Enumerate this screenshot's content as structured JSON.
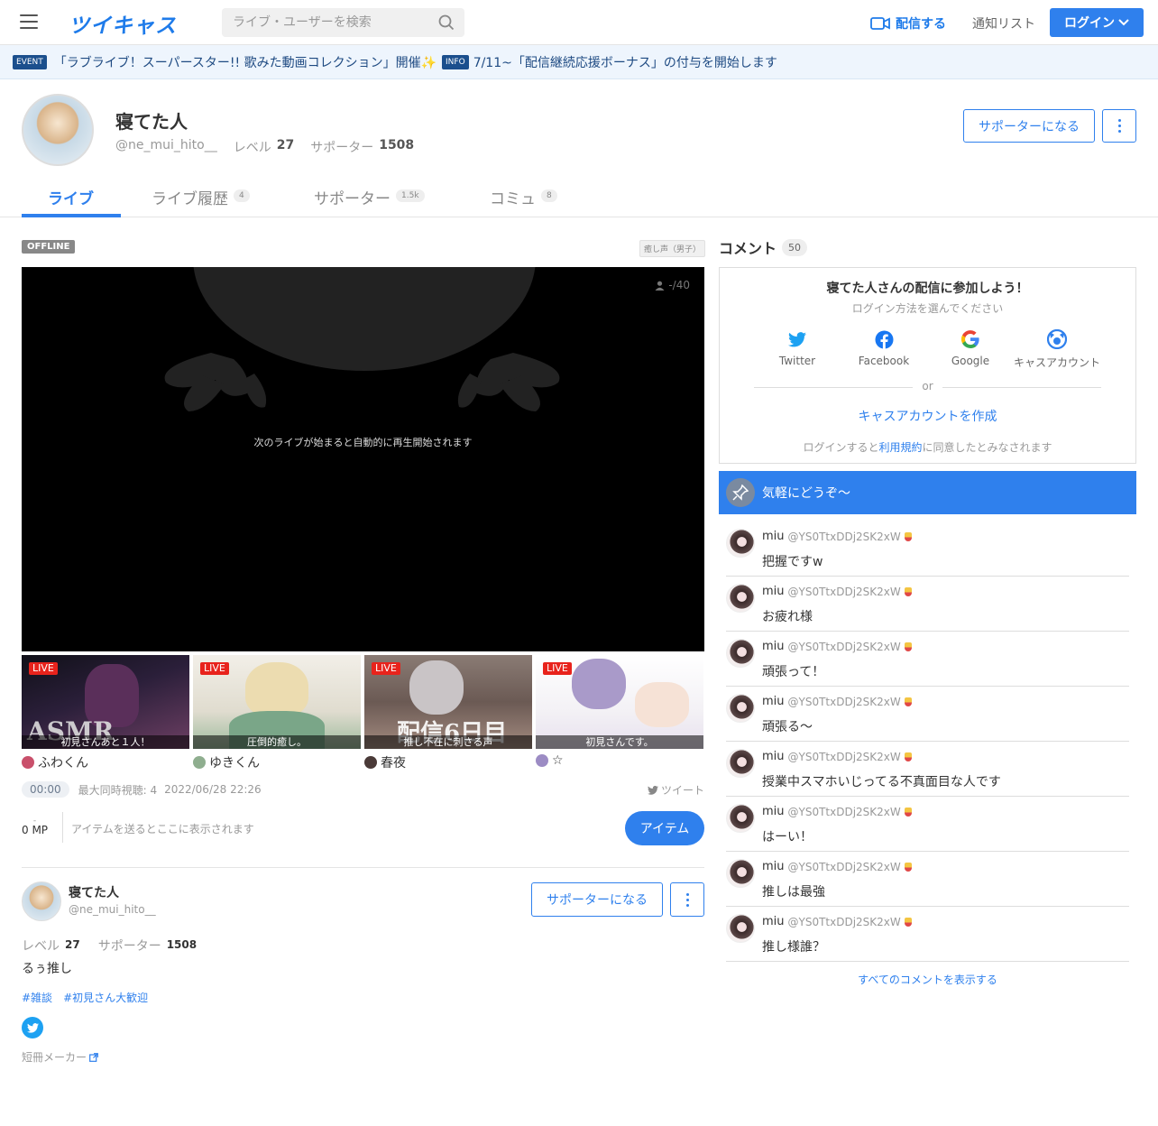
{
  "header": {
    "logo": "ツイキャス",
    "search_placeholder": "ライブ・ユーザーを検索",
    "broadcast_label": "配信する",
    "notify_label": "通知リスト",
    "login_label": "ログイン"
  },
  "ticker": {
    "event_badge": "EVENT",
    "event_text": "「ラブライブ！スーパースター!! 歌みた動画コレクション」開催✨",
    "info_badge": "INFO",
    "info_text": "7/11~「配信継続応援ボーナス」の付与を開始します"
  },
  "profile": {
    "name": "寝てた人",
    "handle": "@ne_mui_hito__",
    "level_label": "レベル",
    "level": "27",
    "supporter_label": "サポーター",
    "supporters": "1508",
    "support_button": "サポーターになる"
  },
  "tabs": [
    {
      "label": "ライブ",
      "count": ""
    },
    {
      "label": "ライブ履歴",
      "count": "4"
    },
    {
      "label": "サポーター",
      "count": "1.5k"
    },
    {
      "label": "コミュ",
      "count": "8"
    }
  ],
  "live": {
    "status": "OFFLINE",
    "category": "癒し声（男子）",
    "viewers": "-/40",
    "player_message": "次のライブが始まると自動的に再生開始されます",
    "time": "00:00",
    "max_viewers": "最大同時視聴: 4",
    "date": "2022/06/28 22:26",
    "tweet_label": "ツイート",
    "mp_value": "0 MP",
    "item_placeholder": "アイテムを送るとここに表示されます",
    "item_button": "アイテム"
  },
  "recommended": [
    {
      "badge": "LIVE",
      "caption": "初見さんあと１人！",
      "user": "ふわくん",
      "overlay": "ASMR",
      "colors": [
        "#2b1f3a",
        "#6d3f63"
      ]
    },
    {
      "badge": "LIVE",
      "caption": "圧倒的癒し。",
      "user": "ゆきくん",
      "overlay": "",
      "colors": [
        "#e9e4da",
        "#9dbb9d"
      ]
    },
    {
      "badge": "LIVE",
      "caption": "推し不在に刺さる声",
      "user": "春夜",
      "overlay": "配信6日目",
      "colors": [
        "#6b5a54",
        "#a48b80"
      ]
    },
    {
      "badge": "LIVE",
      "caption": "初見さんです。",
      "user": "☆",
      "overlay": "",
      "colors": [
        "#f3f1f5",
        "#c5b7d9"
      ]
    }
  ],
  "profile_card": {
    "name": "寝てた人",
    "handle": "@ne_mui_hito__",
    "level_label": "レベル",
    "level": "27",
    "supporter_label": "サポーター",
    "supporters": "1508",
    "bio": "るぅ推し",
    "tags": [
      "#雑談",
      "#初見さん大歓迎"
    ],
    "tanzaku": "短冊メーカー",
    "support_button": "サポーターになる"
  },
  "comments_panel": {
    "title": "コメント",
    "count": "50",
    "login_title": "寝てた人さんの配信に参加しよう！",
    "login_sub": "ログイン方法を選んでください",
    "providers": [
      "Twitter",
      "Facebook",
      "Google",
      "キャスアカウント"
    ],
    "or": "or",
    "create": "キャスアカウントを作成",
    "terms_prefix": "ログインすると",
    "terms_link": "利用規約",
    "terms_suffix": "に同意したとみなされます",
    "pinned": "気軽にどうぞ〜",
    "show_all": "すべてのコメントを表示する"
  },
  "comments": [
    {
      "name": "miu",
      "id": "@YS0TtxDDj2SK2xW",
      "text": "把握ですw"
    },
    {
      "name": "miu",
      "id": "@YS0TtxDDj2SK2xW",
      "text": "お疲れ様"
    },
    {
      "name": "miu",
      "id": "@YS0TtxDDj2SK2xW",
      "text": "頑張って！"
    },
    {
      "name": "miu",
      "id": "@YS0TtxDDj2SK2xW",
      "text": "頑張る〜"
    },
    {
      "name": "miu",
      "id": "@YS0TtxDDj2SK2xW",
      "text": "授業中スマホいじってる不真面目な人です"
    },
    {
      "name": "miu",
      "id": "@YS0TtxDDj2SK2xW",
      "text": "はーい！"
    },
    {
      "name": "miu",
      "id": "@YS0TtxDDj2SK2xW",
      "text": "推しは最強"
    },
    {
      "name": "miu",
      "id": "@YS0TtxDDj2SK2xW",
      "text": "推し様誰？"
    }
  ],
  "colors": {
    "accent": "#2f80ed",
    "live": "#e8231c",
    "pinned_bg": "#2f80ed"
  }
}
